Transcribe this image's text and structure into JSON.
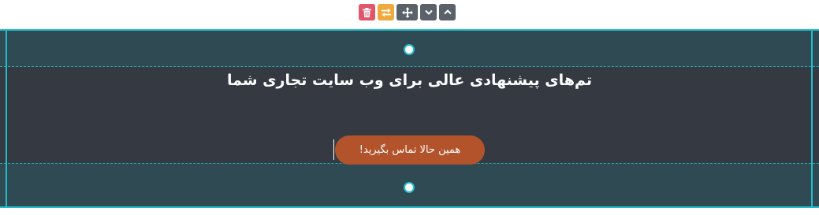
{
  "toolbar": {
    "buttons": [
      {
        "name": "delete",
        "icon": "trash-icon",
        "color": "#e2566b"
      },
      {
        "name": "swap",
        "icon": "swap-arrows-icon",
        "color": "#f0a93c"
      },
      {
        "name": "move",
        "icon": "move-arrows-icon",
        "color": "#5b6169"
      },
      {
        "name": "move-down",
        "icon": "chevron-down-icon",
        "color": "#5b6169"
      },
      {
        "name": "move-up",
        "icon": "chevron-up-icon",
        "color": "#5b6169"
      }
    ]
  },
  "section": {
    "heading": "تم‌های پیشنهادی عالی برای وب سایت تجاری شما",
    "cta_label": "همین حالا تماس بگیرید!",
    "colors": {
      "background": "#353a42",
      "padding_overlay": "#2f4a52",
      "selection_accent": "#22bcc9",
      "cta_background": "#b3532c"
    }
  }
}
